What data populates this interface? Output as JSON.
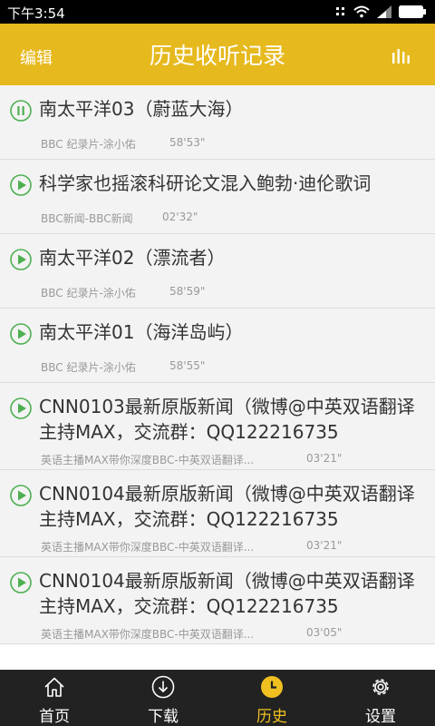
{
  "status_bar": {
    "time": "下午3:54"
  },
  "header": {
    "edit_label": "编辑",
    "title": "历史收听记录",
    "equalizer_icon": "equalizer-icon"
  },
  "items": [
    {
      "title": "南太平洋03（蔚蓝大海）",
      "meta": "BBC  纪录片-涂小佑",
      "duration": "58'53\"",
      "state": "pause"
    },
    {
      "title": "科学家也摇滚科研论文混入鲍勃·迪伦歌词",
      "meta": "BBC新闻-BBC新闻",
      "duration": "02'32\"",
      "state": "play"
    },
    {
      "title": "南太平洋02（漂流者）",
      "meta": "BBC  纪录片-涂小佑",
      "duration": "58'59\"",
      "state": "play"
    },
    {
      "title": "南太平洋01（海洋岛屿）",
      "meta": "BBC  纪录片-涂小佑",
      "duration": "58'55\"",
      "state": "play"
    },
    {
      "title": "CNN0103最新原版新闻（微博@中英双语翻译主持MAX，交流群：QQ122216735",
      "meta": "英语主播MAX带你深度BBC-中英双语翻译...",
      "duration": "03'21\"",
      "state": "play"
    },
    {
      "title": "CNN0104最新原版新闻（微博@中英双语翻译主持MAX，交流群：QQ122216735",
      "meta": "英语主播MAX带你深度BBC-中英双语翻译...",
      "duration": "03'21\"",
      "state": "play"
    },
    {
      "title": "CNN0104最新原版新闻（微博@中英双语翻译主持MAX，交流群：QQ122216735",
      "meta": "英语主播MAX带你深度BBC-中英双语翻译...",
      "duration": "03'05\"",
      "state": "play"
    }
  ],
  "tabs": [
    {
      "label": "首页",
      "icon": "home-icon",
      "active": false
    },
    {
      "label": "下载",
      "icon": "download-icon",
      "active": false
    },
    {
      "label": "历史",
      "icon": "clock-icon",
      "active": true
    },
    {
      "label": "设置",
      "icon": "gear-icon",
      "active": false
    }
  ],
  "colors": {
    "accent": "#e6b91e",
    "play_green": "#4caf50",
    "tab_active": "#f0c020",
    "tabbar_bg": "#222222"
  }
}
